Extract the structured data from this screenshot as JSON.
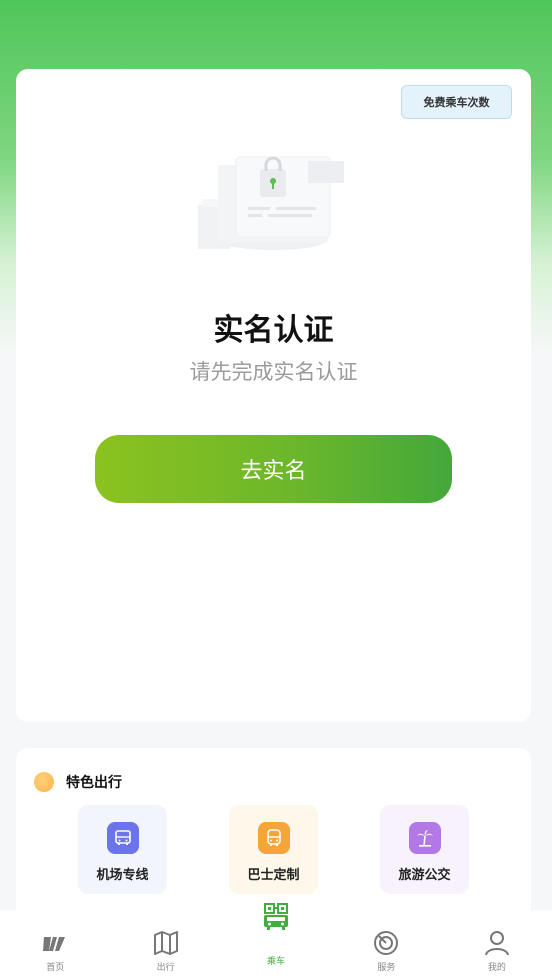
{
  "auth_card": {
    "free_rides_label": "免费乘车次数",
    "title": "实名认证",
    "subtitle": "请先完成实名认证",
    "verify_button": "去实名"
  },
  "features": {
    "title": "特色出行",
    "items": [
      {
        "label": "机场专线",
        "icon": "airport-bus-icon",
        "bg": "#f3f5fd",
        "icon_color": "#6b74e8"
      },
      {
        "label": "巴士定制",
        "icon": "custom-bus-icon",
        "bg": "#fdf8ea",
        "icon_color": "#f5a53a"
      },
      {
        "label": "旅游公交",
        "icon": "palm-tree-icon",
        "bg": "#f7f2fc",
        "icon_color": "#b178e6"
      }
    ]
  },
  "bottom_nav": {
    "items": [
      {
        "label": "首页",
        "icon": "home-logo-icon",
        "active": false
      },
      {
        "label": "出行",
        "icon": "map-icon",
        "active": false
      },
      {
        "label": "乘车",
        "icon": "qr-bus-icon",
        "active": true
      },
      {
        "label": "服务",
        "icon": "service-icon",
        "active": false
      },
      {
        "label": "我的",
        "icon": "user-icon",
        "active": false
      }
    ]
  },
  "colors": {
    "accent_green": "#3fae3c",
    "button_gradient_start": "#8cc220",
    "button_gradient_end": "#43a83a"
  }
}
